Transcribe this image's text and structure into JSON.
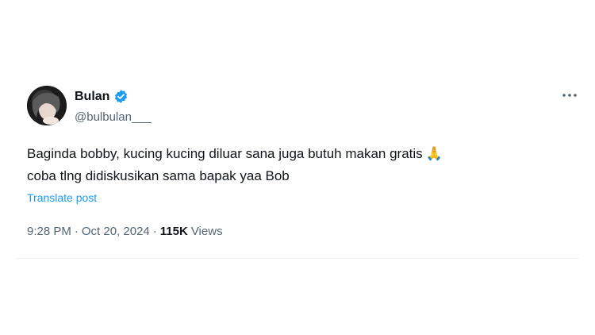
{
  "author": {
    "display_name": "Bulan",
    "handle": "@bulbulan___",
    "verified": true
  },
  "tweet": {
    "line1": "Baginda bobby, kucing kucing diluar sana juga butuh makan gratis",
    "line2": "coba tlng didiskusikan sama bapak yaa Bob",
    "emoji": "🙏",
    "translate_label": "Translate post"
  },
  "meta": {
    "time": "9:28 PM",
    "separator": "·",
    "date": "Oct 20, 2024",
    "views_count": "115K",
    "views_label": "Views"
  },
  "colors": {
    "link": "#1d9bf0",
    "verified": "#1d9bf0",
    "muted": "#536471",
    "text": "#0f1419"
  },
  "icons": {
    "verified": "verified-badge-icon",
    "more": "more-options-icon",
    "emoji": "folded-hands-icon"
  }
}
